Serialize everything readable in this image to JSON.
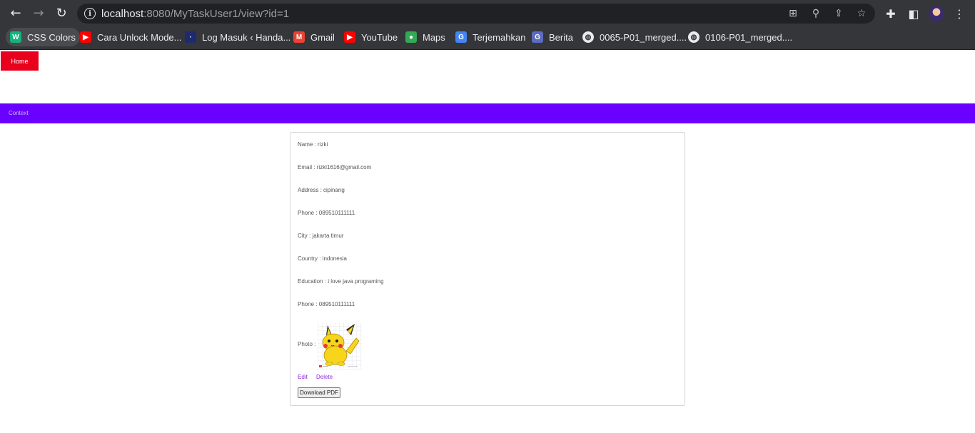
{
  "browser": {
    "url_host": "localhost",
    "url_rest": ":8080/MyTaskUser1/view?id=1",
    "bookmarks": [
      {
        "label": "CSS Colors",
        "icon": "w-icon",
        "color": "#14b37d"
      },
      {
        "label": "Cara Unlock Mode...",
        "icon": "youtube-icon",
        "color": "#ff0000"
      },
      {
        "label": "Log Masuk ‹ Handa...",
        "icon": "site-icon",
        "color": "#1e2a6e"
      },
      {
        "label": "Gmail",
        "icon": "gmail-icon",
        "color": "#ea4335"
      },
      {
        "label": "YouTube",
        "icon": "youtube-icon",
        "color": "#ff0000"
      },
      {
        "label": "Maps",
        "icon": "maps-pin-icon",
        "color": "#34a853"
      },
      {
        "label": "Terjemahkan",
        "icon": "translate-icon",
        "color": "#4285f4"
      },
      {
        "label": "Berita",
        "icon": "news-icon",
        "color": "#5c6bc0"
      },
      {
        "label": "0065-P01_merged....",
        "icon": "globe-icon",
        "color": "#e8eaed"
      },
      {
        "label": "0106-P01_merged....",
        "icon": "globe-icon",
        "color": "#e8eaed"
      }
    ]
  },
  "page": {
    "home_label": "Home",
    "context_label": "Context",
    "details": {
      "name": "Name : rizki",
      "email": "Email : rizki1616@gmail.com",
      "address": "Address : cipinang",
      "phone": "Phone : 089510111111",
      "city": "City : jakarta timur",
      "country": "Country : indonesia",
      "education": "Education : i love java programing",
      "phone2": "Phone : 089510111111"
    },
    "photo_label": "Photo :",
    "edit_label": "Edit",
    "delete_label": "Delete",
    "download_label": "Download PDF"
  },
  "colors": {
    "home_button": "#e8001c",
    "context_bar": "#6a00ff",
    "link": "#8a2be2"
  }
}
